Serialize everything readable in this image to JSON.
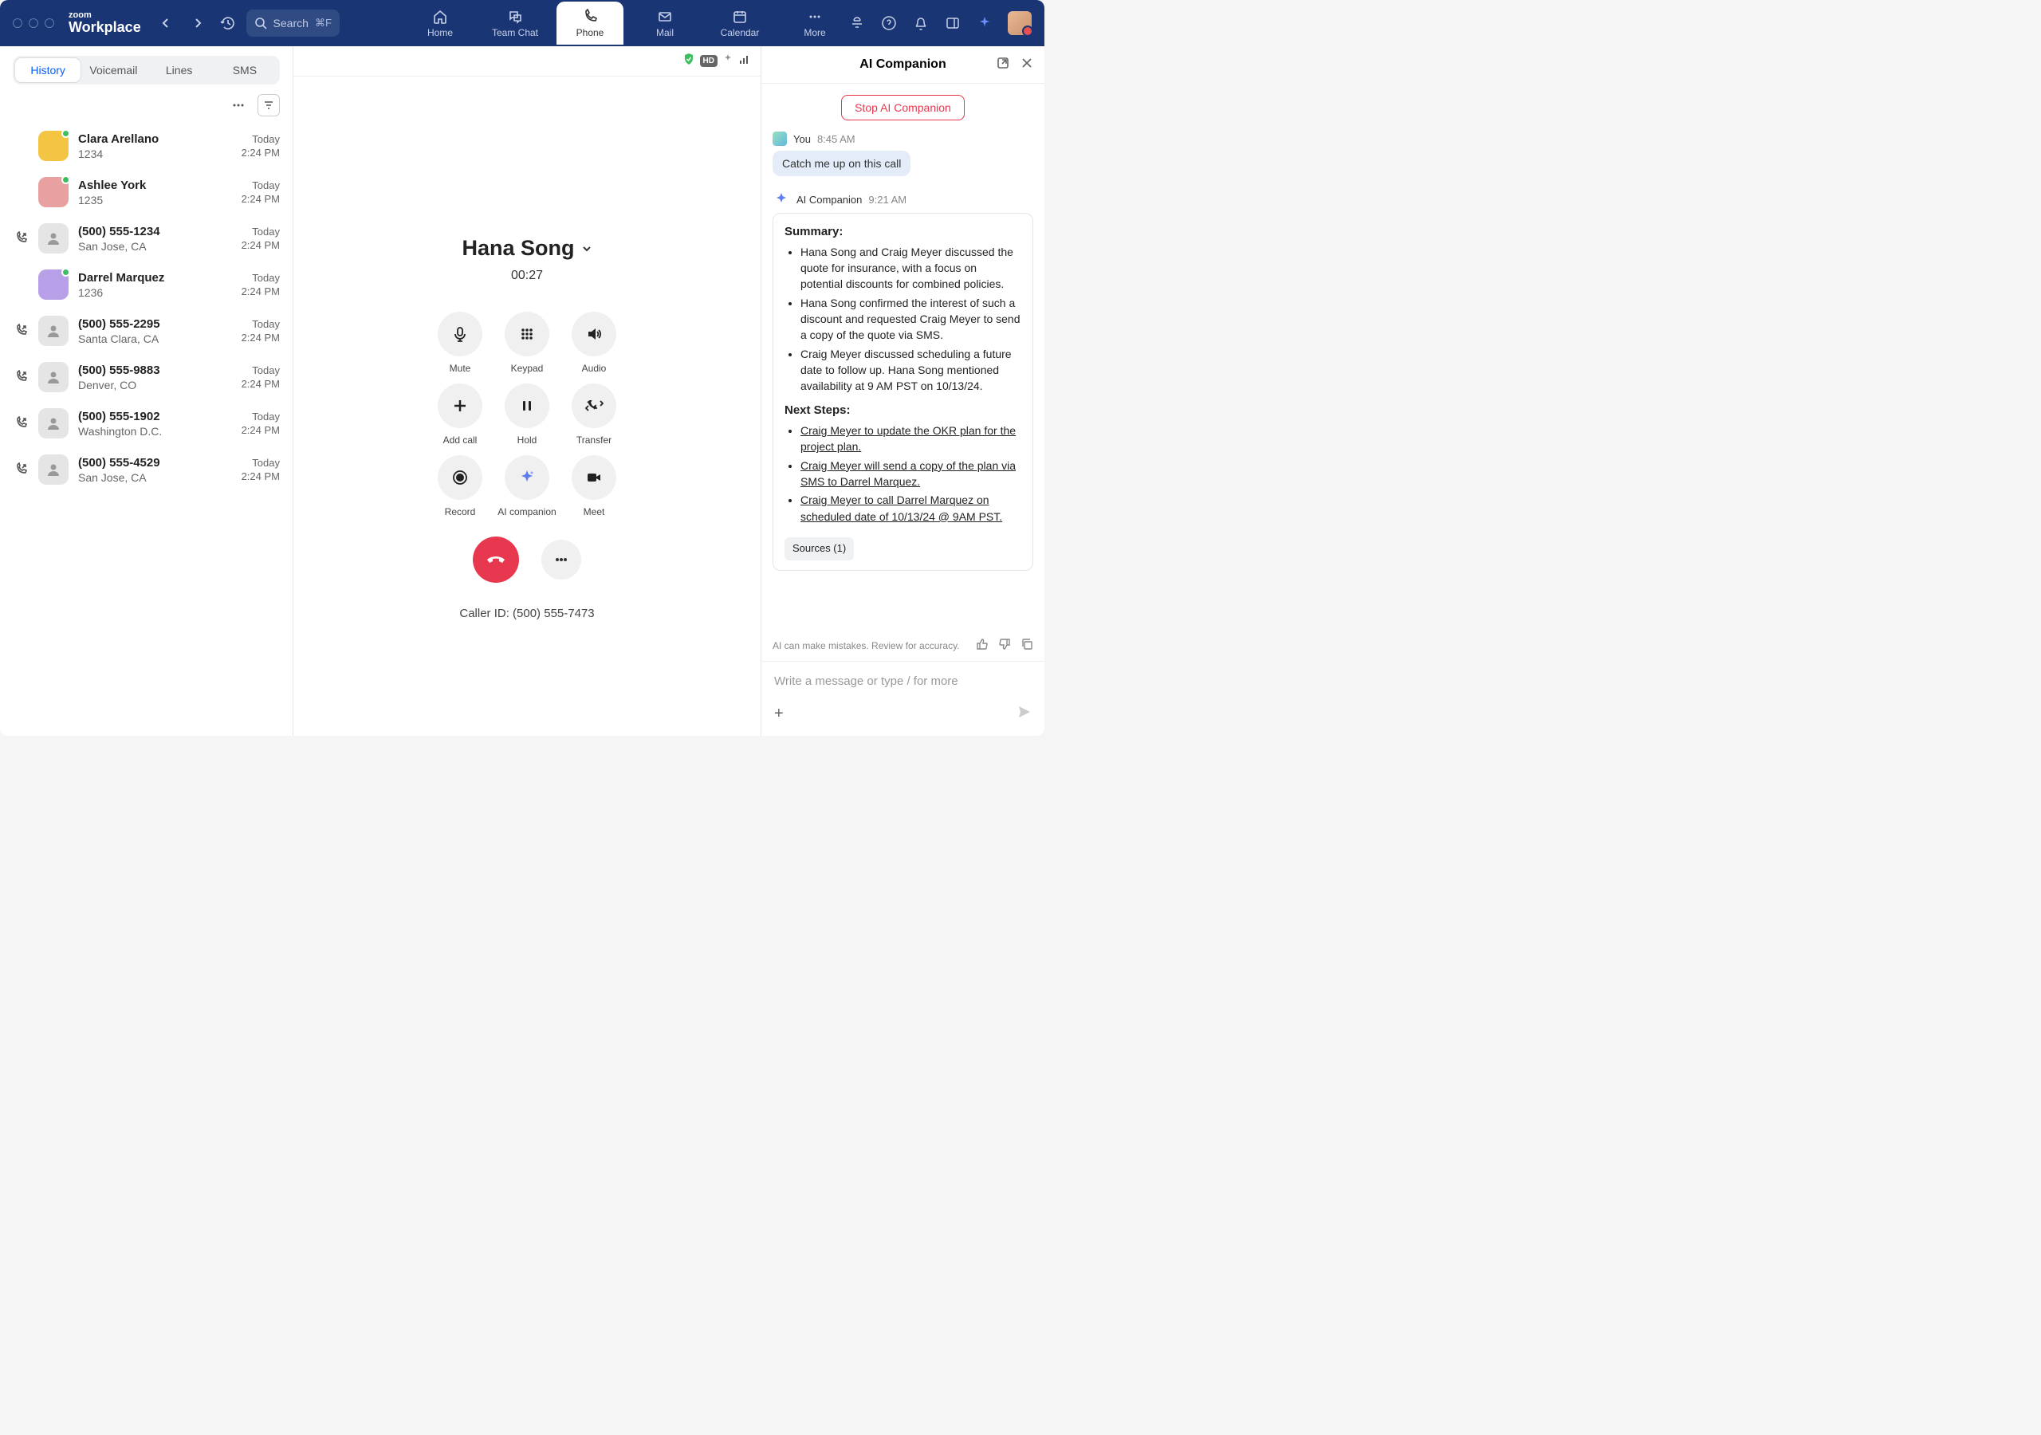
{
  "brand": {
    "line1": "zoom",
    "line2": "Workplace"
  },
  "search": {
    "placeholder": "Search",
    "shortcut": "⌘F"
  },
  "navTabs": {
    "home": "Home",
    "teamChat": "Team Chat",
    "phone": "Phone",
    "mail": "Mail",
    "calendar": "Calendar",
    "more": "More"
  },
  "sidebar": {
    "seg": {
      "history": "History",
      "voicemail": "Voicemail",
      "lines": "Lines",
      "sms": "SMS"
    },
    "items": [
      {
        "name": "Clara Arellano",
        "sub": "1234",
        "day": "Today",
        "time": "2:24 PM",
        "avatarClass": "c1",
        "presence": true,
        "callIcon": false
      },
      {
        "name": "Ashlee York",
        "sub": "1235",
        "day": "Today",
        "time": "2:24 PM",
        "avatarClass": "c2",
        "presence": true,
        "callIcon": false
      },
      {
        "name": "(500) 555-1234",
        "sub": "San Jose, CA",
        "day": "Today",
        "time": "2:24 PM",
        "avatarClass": "",
        "presence": false,
        "callIcon": true
      },
      {
        "name": "Darrel Marquez",
        "sub": "1236",
        "day": "Today",
        "time": "2:24 PM",
        "avatarClass": "c3",
        "presence": true,
        "callIcon": false
      },
      {
        "name": "(500) 555-2295",
        "sub": "Santa Clara, CA",
        "day": "Today",
        "time": "2:24 PM",
        "avatarClass": "",
        "presence": false,
        "callIcon": true
      },
      {
        "name": "(500) 555-9883",
        "sub": "Denver, CO",
        "day": "Today",
        "time": "2:24 PM",
        "avatarClass": "",
        "presence": false,
        "callIcon": true
      },
      {
        "name": "(500) 555-1902",
        "sub": "Washington D.C.",
        "day": "Today",
        "time": "2:24 PM",
        "avatarClass": "",
        "presence": false,
        "callIcon": true
      },
      {
        "name": "(500) 555-4529",
        "sub": "San Jose, CA",
        "day": "Today",
        "time": "2:24 PM",
        "avatarClass": "",
        "presence": false,
        "callIcon": true
      }
    ]
  },
  "call": {
    "name": "Hana Song",
    "timer": "00:27",
    "buttons": {
      "mute": "Mute",
      "keypad": "Keypad",
      "audio": "Audio",
      "addCall": "Add call",
      "hold": "Hold",
      "transfer": "Transfer",
      "record": "Record",
      "aiCompanion": "AI companion",
      "meet": "Meet"
    },
    "callerIdLabel": "Caller ID: (500) 555-7473"
  },
  "centerBadges": {
    "hd": "HD"
  },
  "ai": {
    "title": "AI Companion",
    "stop": "Stop AI Companion",
    "user": {
      "name": "You",
      "time": "8:45 AM",
      "msg": "Catch me up on this call"
    },
    "bot": {
      "name": "AI Companion",
      "time": "9:21 AM"
    },
    "summaryHeading": "Summary:",
    "summary": [
      "Hana Song and Craig Meyer discussed the quote for insurance, with a focus on potential discounts for combined policies.",
      "Hana Song confirmed the interest of such a discount and requested Craig Meyer to send a copy of the quote via SMS.",
      "Craig Meyer discussed scheduling a future date to follow up. Hana Song mentioned availability at 9 AM PST on 10/13/24."
    ],
    "nextStepsHeading": "Next Steps:",
    "nextSteps": [
      "Craig Meyer to update the OKR plan for the project plan.",
      "Craig Meyer will send a copy of the plan via SMS to Darrel Marquez.",
      "Craig Meyer to call Darrel Marquez on scheduled date of 10/13/24 @ 9AM PST."
    ],
    "sources": "Sources (1)",
    "disclaimer": "AI can make mistakes. Review for accuracy.",
    "inputPlaceholder": "Write a message or type / for more"
  }
}
